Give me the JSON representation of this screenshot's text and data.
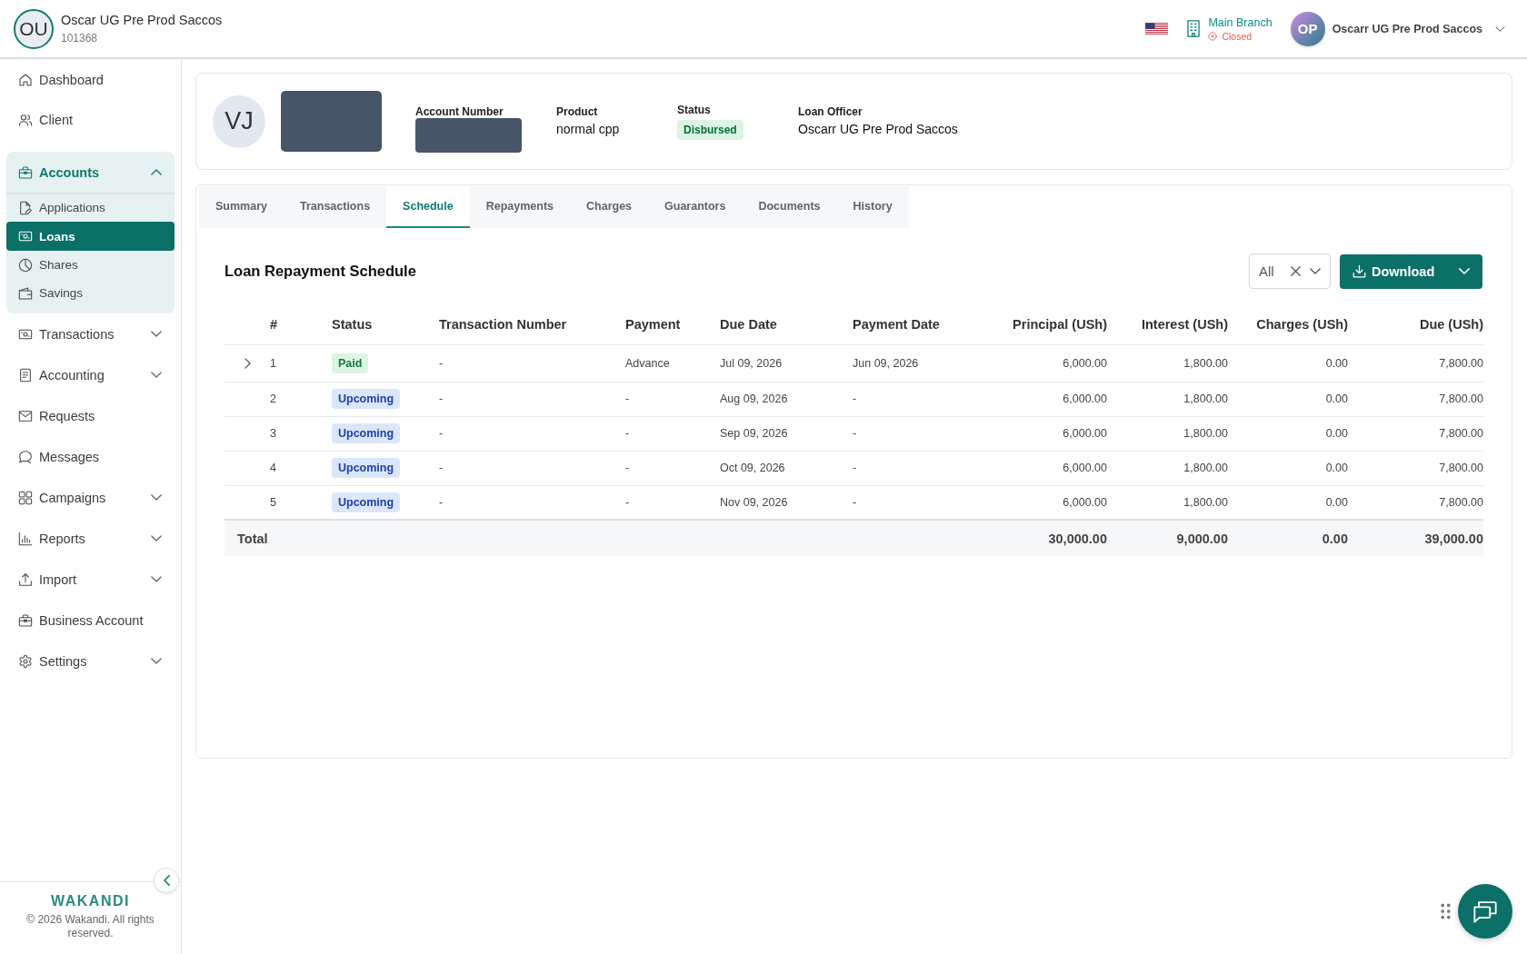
{
  "header": {
    "org": {
      "initials": "OU",
      "name": "Oscar UG Pre Prod Saccos",
      "code": "101368"
    },
    "branch": {
      "name": "Main Branch",
      "status": "Closed",
      "open": false
    },
    "user": {
      "initials": "OP",
      "name": "Oscarr UG Pre Prod Saccos"
    }
  },
  "sidebar": {
    "items": [
      {
        "label": "Dashboard",
        "kind": "link",
        "selected": false
      },
      {
        "label": "Client",
        "kind": "link",
        "selected": false
      },
      {
        "label": "Accounts",
        "kind": "group",
        "selected": false,
        "expanded": true,
        "children": [
          {
            "label": "Applications",
            "selected": false
          },
          {
            "label": "Loans",
            "selected": true
          },
          {
            "label": "Shares",
            "selected": false
          },
          {
            "label": "Savings",
            "selected": false
          }
        ]
      },
      {
        "label": "Transactions",
        "kind": "group",
        "selected": false,
        "expanded": false
      },
      {
        "label": "Accounting",
        "kind": "group",
        "selected": false,
        "expanded": false
      },
      {
        "label": "Requests",
        "kind": "link",
        "selected": false
      },
      {
        "label": "Messages",
        "kind": "link",
        "selected": false
      },
      {
        "label": "Campaigns",
        "kind": "group",
        "selected": false,
        "expanded": false
      },
      {
        "label": "Reports",
        "kind": "group",
        "selected": false,
        "expanded": false
      },
      {
        "label": "Import",
        "kind": "group",
        "selected": false,
        "expanded": false
      },
      {
        "label": "Business Account",
        "kind": "link",
        "selected": false
      },
      {
        "label": "Settings",
        "kind": "group",
        "selected": false,
        "expanded": false
      }
    ],
    "footer": {
      "brand": "WAKANDI",
      "copyright": "© 2026 Wakandi. All rights reserved."
    }
  },
  "account": {
    "initials": "VJ",
    "name_redacted": true,
    "fields": [
      {
        "label": "Account Number",
        "kind": "redacted"
      },
      {
        "label": "Product",
        "kind": "text",
        "value": "normal cpp"
      },
      {
        "label": "Status",
        "kind": "badge",
        "value": "Disbursed"
      },
      {
        "label": "Loan Officer",
        "kind": "text",
        "value": "Oscarr UG Pre Prod Saccos"
      }
    ]
  },
  "tabs": [
    {
      "label": "Summary",
      "selected": false
    },
    {
      "label": "Transactions",
      "selected": false
    },
    {
      "label": "Schedule",
      "selected": true
    },
    {
      "label": "Repayments",
      "selected": false
    },
    {
      "label": "Charges",
      "selected": false
    },
    {
      "label": "Guarantors",
      "selected": false
    },
    {
      "label": "Documents",
      "selected": false
    },
    {
      "label": "History",
      "selected": false
    }
  ],
  "schedule": {
    "title": "Loan Repayment Schedule",
    "filter": {
      "value": "All"
    },
    "download": {
      "label": "Download"
    },
    "columns": [
      {
        "label": "#",
        "kind": "text"
      },
      {
        "label": "Status",
        "kind": "text"
      },
      {
        "label": "Transaction Number",
        "kind": "text"
      },
      {
        "label": "Payment",
        "kind": "text"
      },
      {
        "label": "Due Date",
        "kind": "text"
      },
      {
        "label": "Payment Date",
        "kind": "text"
      },
      {
        "label": "Principal (USh)",
        "kind": "amount"
      },
      {
        "label": "Interest (USh)",
        "kind": "amount"
      },
      {
        "label": "Charges (USh)",
        "kind": "amount"
      },
      {
        "label": "Due (USh)",
        "kind": "amount"
      }
    ],
    "rows": [
      {
        "number": "1",
        "expandable": true,
        "status": {
          "label": "Paid",
          "kind": "paid"
        },
        "values": [
          "-",
          "Advance",
          "Jul 09, 2026",
          "Jun 09, 2026",
          "6,000.00",
          "1,800.00",
          "0.00",
          "7,800.00"
        ]
      },
      {
        "number": "2",
        "expandable": false,
        "status": {
          "label": "Upcoming",
          "kind": "upcoming"
        },
        "values": [
          "-",
          "-",
          "Aug 09, 2026",
          "-",
          "6,000.00",
          "1,800.00",
          "0.00",
          "7,800.00"
        ]
      },
      {
        "number": "3",
        "expandable": false,
        "status": {
          "label": "Upcoming",
          "kind": "upcoming"
        },
        "values": [
          "-",
          "-",
          "Sep 09, 2026",
          "-",
          "6,000.00",
          "1,800.00",
          "0.00",
          "7,800.00"
        ]
      },
      {
        "number": "4",
        "expandable": false,
        "status": {
          "label": "Upcoming",
          "kind": "upcoming"
        },
        "values": [
          "-",
          "-",
          "Oct 09, 2026",
          "-",
          "6,000.00",
          "1,800.00",
          "0.00",
          "7,800.00"
        ]
      },
      {
        "number": "5",
        "expandable": false,
        "status": {
          "label": "Upcoming",
          "kind": "upcoming"
        },
        "values": [
          "-",
          "-",
          "Nov 09, 2026",
          "-",
          "6,000.00",
          "1,800.00",
          "0.00",
          "7,800.00"
        ]
      }
    ],
    "total": {
      "label": "Total",
      "values": [
        "30,000.00",
        "9,000.00",
        "0.00",
        "39,000.00"
      ]
    }
  }
}
